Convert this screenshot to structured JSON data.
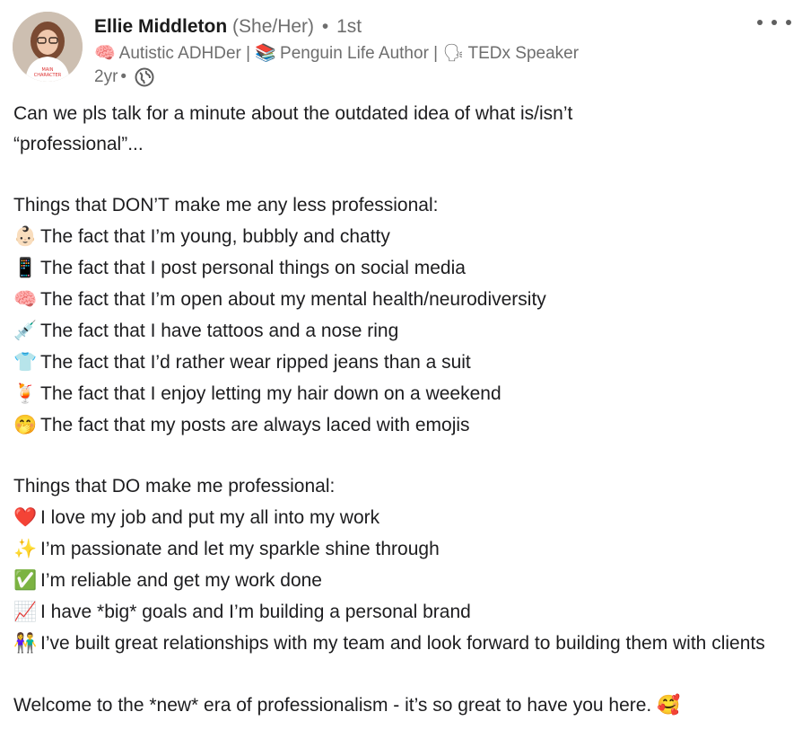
{
  "author": {
    "name": "Ellie Middleton",
    "pronouns": "(She/Her)",
    "separator": "•",
    "degree": "1st",
    "headline": [
      {
        "icon": "brain-icon",
        "emoji": "🧠",
        "text": "Autistic ADHDer |"
      },
      {
        "icon": "books-icon",
        "emoji": "📚",
        "text": "Penguin Life Author |"
      },
      {
        "icon": "speaking-head-icon",
        "emoji": "🗣",
        "text": "TEDx Speaker"
      }
    ],
    "time_ago": "2yr",
    "visibility_icon": "globe-icon"
  },
  "post": {
    "intro": "Can we pls talk for a minute about the outdated idea of what is/isn’t “professional”...",
    "dont_heading": "Things that DON’T make me any less professional:",
    "dont_items": [
      {
        "icon": "baby-icon",
        "emoji": "👶🏻",
        "text": "The fact that I’m young, bubbly and chatty"
      },
      {
        "icon": "phone-icon",
        "emoji": "📱",
        "text": "The fact that I post personal things on social media"
      },
      {
        "icon": "brain-icon",
        "emoji": "🧠",
        "text": "The fact that I’m open about my mental health/neurodiversity"
      },
      {
        "icon": "syringe-icon",
        "emoji": "💉",
        "text": "The fact that I have tattoos and a nose ring"
      },
      {
        "icon": "shirt-icon",
        "emoji": "👕",
        "text": "The fact that I’d rather wear ripped jeans than a suit"
      },
      {
        "icon": "tropical-drink-icon",
        "emoji": "🍹",
        "text": "The fact that I enjoy letting my hair down on a weekend"
      },
      {
        "icon": "hushed-face-icon",
        "emoji": "🤭",
        "text": "The fact that my posts are always laced with emojis"
      }
    ],
    "do_heading": "Things that DO make me professional:",
    "do_items": [
      {
        "icon": "red-heart-icon",
        "emoji": "❤️",
        "text": "I love my job and put my all into my work"
      },
      {
        "icon": "sparkles-icon",
        "emoji": "✨",
        "text": "I’m passionate and let my sparkle shine through"
      },
      {
        "icon": "check-mark-icon",
        "emoji": "✅",
        "text": "I’m reliable and get my work done"
      },
      {
        "icon": "chart-increasing-icon",
        "emoji": "📈",
        "text": "I have *big* goals and I’m building a personal brand"
      },
      {
        "icon": "people-holding-hands-icon",
        "emoji": "👫",
        "text": "I’ve built great relationships with my team and look forward to building them with clients"
      }
    ],
    "closing": "Welcome to the *new* era of professionalism - it’s so great to have you here.",
    "closing_emoji": "🥰",
    "closing_icon": "smiling-face-hearts-icon"
  },
  "colors": {
    "text": "#1d1d1f",
    "meta": "#6e6e6e",
    "background": "#ffffff"
  }
}
